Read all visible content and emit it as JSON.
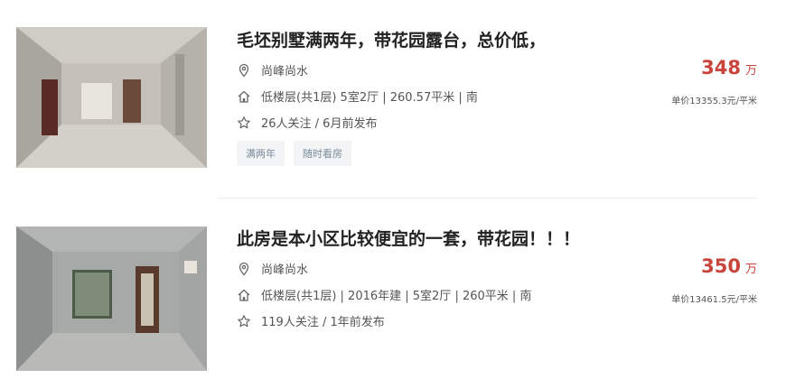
{
  "listings": [
    {
      "title": "毛坯别墅满两年，带花园露台，总价低，",
      "community": "尚峰尚水",
      "house_info": "低楼层(共1层) 5室2厅 | 260.57平米 | 南",
      "follow_info": "26人关注 / 6月前发布",
      "tags": [
        "满两年",
        "随时看房"
      ],
      "price": "348",
      "price_unit": "万",
      "unit_price": "单价13355.3元/平米"
    },
    {
      "title": "此房是本小区比较便宜的一套，带花园！！！",
      "community": "尚峰尚水",
      "house_info": "低楼层(共1层) | 2016年建 | 5室2厅 | 260平米 | 南",
      "follow_info": "119人关注 / 1年前发布",
      "price": "350",
      "price_unit": "万",
      "unit_price": "单价13461.5元/平米"
    }
  ],
  "icons": {
    "location": "location-pin-icon",
    "house": "house-icon",
    "star": "star-icon"
  },
  "colors": {
    "price": "#c9443b",
    "tag_bg": "#f2f4f6",
    "tag_text": "#7a8a99"
  }
}
